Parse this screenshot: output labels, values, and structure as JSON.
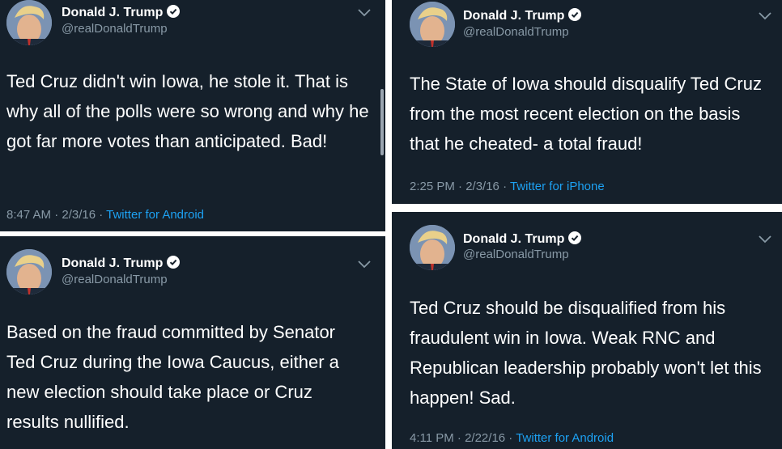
{
  "tweets": [
    {
      "author": "Donald J. Trump",
      "handle": "@realDonaldTrump",
      "text": "Ted Cruz didn't win Iowa, he stole it. That is why all of the polls were so wrong and why he got far more votes than anticipated. Bad!",
      "time": "8:47 AM · 2/3/16 · ",
      "source": "Twitter for Android"
    },
    {
      "author": "Donald J. Trump",
      "handle": "@realDonaldTrump",
      "text": "Based on the fraud committed by Senator Ted Cruz during the Iowa Caucus, either a new election should take place or Cruz results nullified."
    },
    {
      "author": "Donald J. Trump",
      "handle": "@realDonaldTrump",
      "text": "The State of Iowa should disqualify Ted Cruz from the most recent election on the basis that he cheated- a total fraud!",
      "time": "2:25 PM · 2/3/16 · ",
      "source": "Twitter for iPhone"
    },
    {
      "author": "Donald J. Trump",
      "handle": "@realDonaldTrump",
      "text": "Ted Cruz should be disqualified from his fraudulent win in Iowa. Weak RNC and Republican leadership probably won't let this happen! Sad.",
      "time": "4:11 PM · 2/22/16 · ",
      "source": "Twitter for Android"
    }
  ],
  "colors": {
    "card_background": "#15202b",
    "secondary_text": "#8899a6",
    "link": "#1da1f2",
    "verified": "#ffffff"
  },
  "icons": [
    "avatar",
    "verified-badge-icon",
    "chevron-down-icon"
  ]
}
